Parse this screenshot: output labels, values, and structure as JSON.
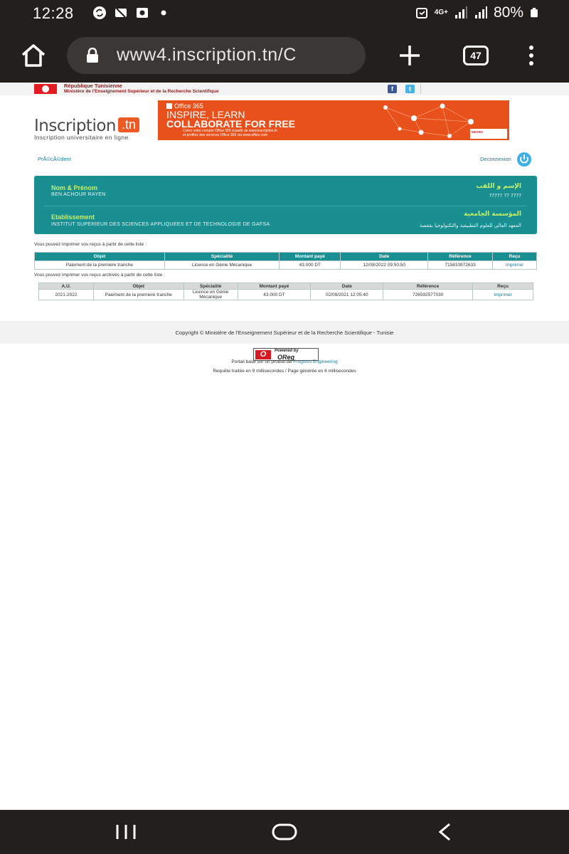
{
  "status_bar": {
    "time": "12:28",
    "network": "4G+",
    "battery": "80%",
    "icons": [
      "sync-icon",
      "wifi-off-icon",
      "media-icon",
      "dot-icon",
      "alarm-icon",
      "signal-icon",
      "signal-icon",
      "battery-icon"
    ]
  },
  "browser": {
    "url": "www4.inscription.tn/C",
    "tab_count": "47"
  },
  "header": {
    "republic": "République Tunisienne",
    "ministry": "Ministère de l'Enseignement Supérieur et de la Recherche Scientifique",
    "facebook": "f",
    "twitter": "t"
  },
  "logo": {
    "word": "Inscription",
    "tn": ".tn",
    "tagline": "Inscription universitaire en ligne"
  },
  "banner": {
    "office": "Office 365",
    "line1": "INSPIRE, LEARN",
    "line2": "COLLABORATE FOR FREE",
    "small1": "Créez votre compte Office 365 à partir de www.inscription.tn",
    "small2": "et profitez des services Office 365 via www.office.com",
    "badge": "MESRS"
  },
  "nav": {
    "previous": "PrÃ©cÃ©dent",
    "logout": "Deconnexion"
  },
  "student": {
    "name_label": "Nom & Prénom",
    "name_label_ar": "الإسم و اللقب",
    "name_value": "BEN ACHOUR RAYEN",
    "name_value_ar": "???? ?? ?????",
    "inst_label": "Etablissement",
    "inst_label_ar": "المؤسسة الجامعية",
    "inst_value": "INSTITUT SUPERIEUR DES SCIENCES APPLIQUEES ET DE TECHNOLOGIE DE GAFSA",
    "inst_value_ar": "المعهد العالي للعلوم التطبيقية والتكنولوجيا بقفصة"
  },
  "receipts": {
    "intro": "Vous pouvez imprimer vos reçus à partir de cette liste :",
    "headers": [
      "Objet",
      "Spécialité",
      "Montant payé",
      "Date",
      "Référence",
      "Reçu"
    ],
    "rows": [
      [
        "Paiement de la premiere tranche",
        "Licence en Génie Mécanique",
        "43.000 DT",
        "12/09/2022 09:50:50",
        "715810972633",
        "Imprimer"
      ]
    ]
  },
  "archives": {
    "intro": "Vous pouvez imprimer vos reçus archivés à partir de cette liste :",
    "headers": [
      "A.U.",
      "Objet",
      "Spécialité",
      "Montant payé",
      "Date",
      "Référence",
      "Reçu"
    ],
    "rows": [
      [
        "2021-2022",
        "Paiement de la premiere tranche",
        "Licence en Génie Mécanique",
        "43.000 DT",
        "02/09/2021 12:05:40",
        "726592577030",
        "Imprimer"
      ]
    ]
  },
  "footer": {
    "copyright": "Copyright © Ministère de l'Enseignement Supérieur et de la Recherche Scientifique - Tunisie",
    "powered_top": "Powered by",
    "powered_brand": "OReg",
    "portal_prefix": "Portail basé sur un produit de ",
    "portal_link": "Progress Engineering",
    "timing": "Requête traitée en 9 millisecondes / Page générée en 6 millisecondes"
  }
}
